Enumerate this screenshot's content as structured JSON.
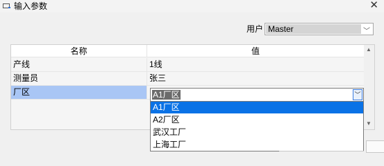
{
  "window": {
    "title": "输入参数",
    "close_glyph": "✕"
  },
  "user": {
    "label": "用户",
    "value": "Master"
  },
  "table": {
    "columns": [
      "名称",
      "值"
    ],
    "rows": [
      {
        "name": "产线",
        "value": "1线"
      },
      {
        "name": "测量员",
        "value": "张三"
      },
      {
        "name": "厂区",
        "value": "A1厂区"
      }
    ]
  },
  "dropdown": {
    "options": [
      "A1厂区",
      "A2厂区",
      "武汉工厂",
      "上海工厂"
    ],
    "selected": "A1厂区"
  },
  "icons": [
    "window-icon",
    "close-icon",
    "chevron-down-icon",
    "scroll-up-icon",
    "scroll-down-icon"
  ],
  "colors": {
    "selected_row": "#a9c6f5",
    "selected_option": "#0a72e6"
  }
}
